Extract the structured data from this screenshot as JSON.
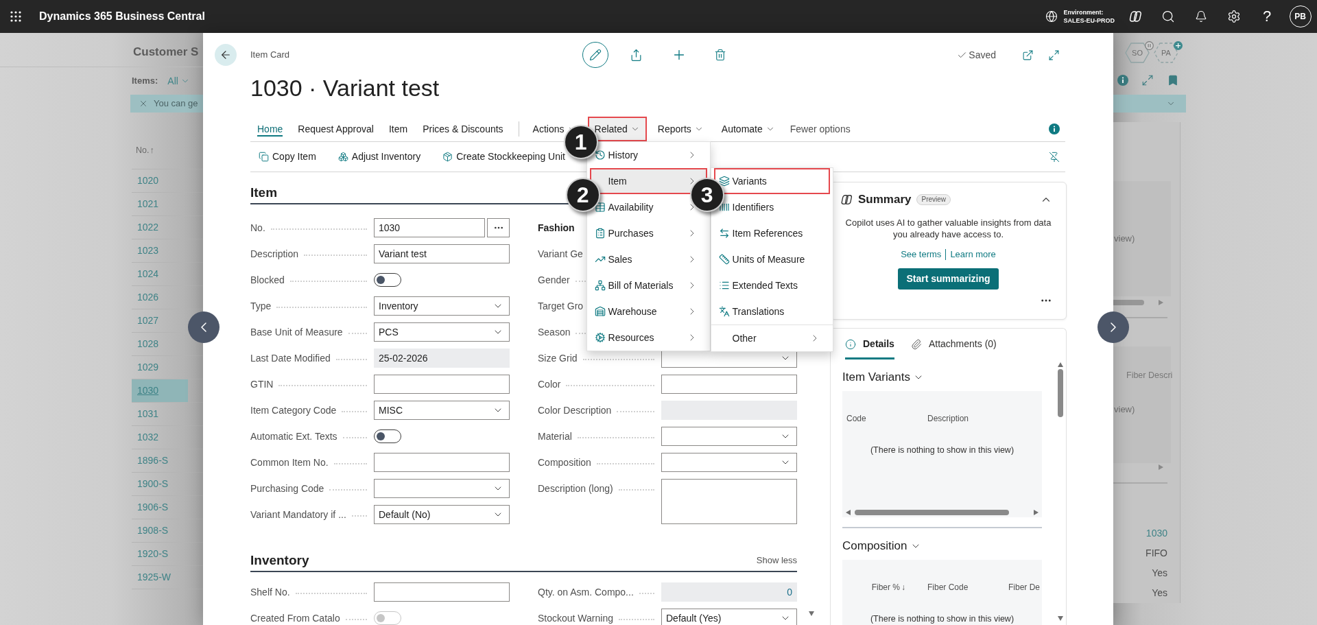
{
  "top_bar": {
    "app_title": "Dynamics 365 Business Central",
    "environment_label": "Environment:",
    "environment_name": "SALES-EU-PROD",
    "help": "?",
    "avatar": "PB"
  },
  "background_left": {
    "title": "Customer S",
    "filter_label": "Items:",
    "filter_value": "All",
    "banner": "You can ge",
    "column": {
      "label": "No.",
      "sort": "↑"
    },
    "rows": [
      {
        "no": "1020",
        "selected": false
      },
      {
        "no": "1021",
        "selected": false
      },
      {
        "no": "1022",
        "selected": false
      },
      {
        "no": "1023",
        "selected": false
      },
      {
        "no": "1024",
        "selected": false
      },
      {
        "no": "1026",
        "selected": false
      },
      {
        "no": "1027",
        "selected": false
      },
      {
        "no": "1028",
        "selected": false
      },
      {
        "no": "1029",
        "selected": false
      },
      {
        "no": "1030",
        "selected": true
      },
      {
        "no": "1031",
        "selected": false
      },
      {
        "no": "1032",
        "selected": false
      },
      {
        "no": "1896-S",
        "selected": false
      },
      {
        "no": "1900-S",
        "selected": false
      },
      {
        "no": "1906-S",
        "selected": false
      },
      {
        "no": "1908-S",
        "selected": false
      },
      {
        "no": "1920-S",
        "selected": false
      },
      {
        "no": "1925-W",
        "selected": false
      }
    ]
  },
  "background_right": {
    "badges": [
      {
        "label": "SO",
        "kind": "paused"
      },
      {
        "label": "PA",
        "kind": "new"
      }
    ],
    "parts": [
      {
        "message": "view)"
      },
      {
        "column": "Fiber Descri",
        "message": "view)"
      }
    ],
    "values": [
      {
        "text": "1030",
        "kind": "link"
      },
      {
        "text": "FIFO",
        "kind": "plain"
      },
      {
        "text": "Yes",
        "kind": "plain"
      },
      {
        "text": "Yes",
        "kind": "plain"
      }
    ]
  },
  "dialog": {
    "caption": "Item Card",
    "title": "1030 · Variant test",
    "status": "Saved",
    "tabs": [
      {
        "label": "Home",
        "selected": true
      },
      {
        "label": "Request Approval",
        "selected": false
      },
      {
        "label": "Item",
        "selected": false
      },
      {
        "label": "Prices & Discounts",
        "selected": false
      }
    ],
    "menus": [
      {
        "label": "Actions",
        "open": false,
        "annotated": false
      },
      {
        "label": "Related",
        "open": true,
        "annotated": true,
        "callout": "1",
        "items": [
          {
            "label": "History",
            "selected": false,
            "annotated": false
          },
          {
            "label": "Item",
            "selected": true,
            "annotated": true,
            "callout": "2",
            "submenu": {
              "items": [
                {
                  "label": "Variants",
                  "selected": false,
                  "annotated": true,
                  "callout": "3"
                },
                {
                  "label": "Identifiers",
                  "selected": false,
                  "annotated": false
                },
                {
                  "label": "Item References",
                  "selected": false,
                  "annotated": false
                },
                {
                  "label": "Units of Measure",
                  "selected": false,
                  "annotated": false
                },
                {
                  "label": "Extended Texts",
                  "selected": false,
                  "annotated": false
                },
                {
                  "label": "Translations",
                  "selected": false,
                  "annotated": false
                }
              ],
              "more": "Other"
            }
          },
          {
            "label": "Availability",
            "selected": false,
            "annotated": false
          },
          {
            "label": "Purchases",
            "selected": false,
            "annotated": false
          },
          {
            "label": "Sales",
            "selected": false,
            "annotated": false
          },
          {
            "label": "Bill of Materials",
            "selected": false,
            "annotated": false
          },
          {
            "label": "Warehouse",
            "selected": false,
            "annotated": false
          },
          {
            "label": "Resources",
            "selected": false,
            "annotated": false
          }
        ]
      },
      {
        "label": "Reports",
        "open": false,
        "annotated": false
      },
      {
        "label": "Automate",
        "open": false,
        "annotated": false
      }
    ],
    "fewer_options": "Fewer options",
    "promoted_actions": [
      "Copy Item",
      "Adjust Inventory",
      "Create Stockkeeping Unit"
    ],
    "general": {
      "title": "Item",
      "fields_left": [
        {
          "label": "No.",
          "kind": "lookup",
          "value": "1030"
        },
        {
          "label": "Description",
          "kind": "text",
          "value": "Variant test"
        },
        {
          "label": "Blocked",
          "kind": "toggle",
          "on": false,
          "disabled": false
        },
        {
          "label": "Type",
          "kind": "dropdown",
          "value": "Inventory"
        },
        {
          "label": "Base Unit of Measure",
          "kind": "dropdown",
          "value": "PCS"
        },
        {
          "label": "Last Date Modified",
          "kind": "readonly",
          "value": "25-02-2026"
        },
        {
          "label": "GTIN",
          "kind": "text"
        },
        {
          "label": "Item Category Code",
          "kind": "dropdown",
          "value": "MISC"
        },
        {
          "label": "Automatic Ext. Texts",
          "kind": "toggle",
          "on": false,
          "disabled": false
        },
        {
          "label": "Common Item No.",
          "kind": "text"
        },
        {
          "label": "Purchasing Code",
          "kind": "dropdown"
        },
        {
          "label": "Variant Mandatory if ...",
          "kind": "dropdown",
          "value": "Default (No)"
        }
      ],
      "group_title": "Fashion",
      "fields_right": [
        {
          "label": "Variant Ge",
          "kind": "covered"
        },
        {
          "label": "Gender",
          "kind": "covered"
        },
        {
          "label": "Target Gro",
          "kind": "covered"
        },
        {
          "label": "Season",
          "kind": "covered"
        },
        {
          "label": "Size Grid",
          "kind": "dropdown"
        },
        {
          "label": "Color",
          "kind": "text"
        },
        {
          "label": "Color Description",
          "kind": "readonly"
        },
        {
          "label": "Material",
          "kind": "dropdown"
        },
        {
          "label": "Composition",
          "kind": "dropdown"
        },
        {
          "label": "Description (long)",
          "kind": "multiline"
        }
      ]
    },
    "inventory": {
      "title": "Inventory",
      "toggle_label": "Show less",
      "fields_left": [
        {
          "label": "Shelf No.",
          "kind": "text"
        },
        {
          "label": "Created From Catalo",
          "kind": "toggle",
          "on": false,
          "disabled": true
        }
      ],
      "fields_right": [
        {
          "label": "Qty. on Asm. Compo...",
          "kind": "readonly_number",
          "value": "0"
        },
        {
          "label": "Stockout Warning",
          "kind": "dropdown",
          "value": "Default (Yes)"
        }
      ]
    },
    "summary": {
      "title": "Summary",
      "badge": "Preview",
      "expanded": true,
      "text": "Copilot uses AI to gather valuable insights from data you already have access to.",
      "links": [
        "See terms",
        "Learn more"
      ],
      "button": "Start summarizing"
    },
    "factbox_tabs": [
      {
        "label": "Details",
        "selected": true
      },
      {
        "label": "Attachments (0)",
        "selected": false
      }
    ],
    "factbox_parts": [
      {
        "title": "Item Variants",
        "columns": [
          {
            "label": "Code",
            "kind": "text"
          },
          {
            "label": "Description",
            "kind": "text"
          }
        ],
        "empty_text": "(There is nothing to show in this view)"
      },
      {
        "title": "Composition",
        "columns": [
          {
            "label": "Fiber %",
            "kind": "number",
            "sort": "↓"
          },
          {
            "label": "Fiber Code",
            "kind": "text"
          },
          {
            "label": "Fiber De",
            "kind": "text"
          }
        ],
        "empty_text": "(There is nothing to show in this view)"
      }
    ]
  }
}
